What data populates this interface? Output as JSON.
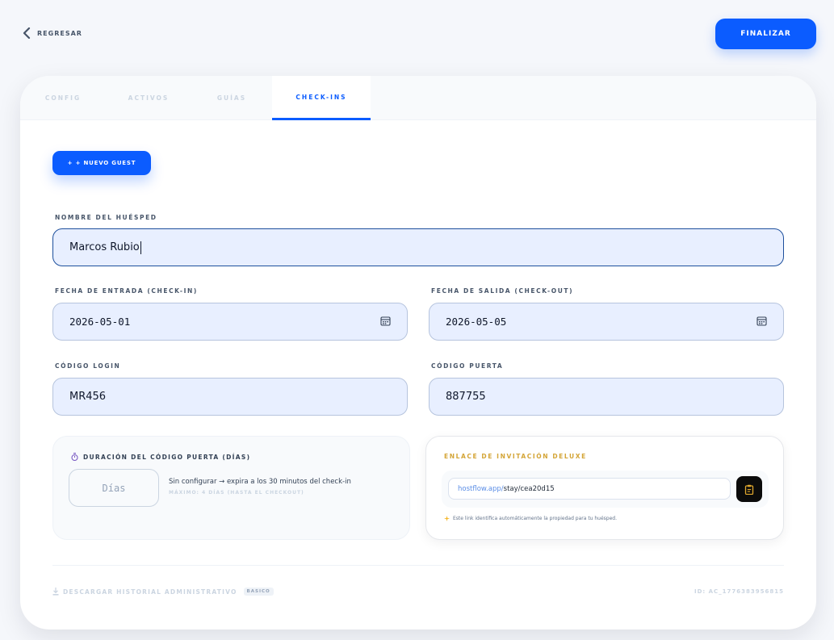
{
  "header": {
    "back_label": "REGRESAR",
    "finish_label": "FINALIZAR"
  },
  "tabs": [
    {
      "label": "CONFIG",
      "active": false
    },
    {
      "label": "ACTIVOS",
      "active": false
    },
    {
      "label": "GUÍAS",
      "active": false
    },
    {
      "label": "CHECK-INS",
      "active": true
    }
  ],
  "actions": {
    "new_guest_label": "+ + NUEVO GUEST"
  },
  "form": {
    "guest_name": {
      "label": "NOMBRE DEL HUÉSPED",
      "value": "Marcos Rubio"
    },
    "check_in": {
      "label": "FECHA DE ENTRADA (CHECK-IN)",
      "value": "2026-05-01"
    },
    "check_out": {
      "label": "FECHA DE SALIDA (CHECK-OUT)",
      "value": "2026-05-05"
    },
    "login_code": {
      "label": "CÓDIGO LOGIN",
      "value": "MR456"
    },
    "door_code": {
      "label": "CÓDIGO PUERTA",
      "value": "887755"
    }
  },
  "duration": {
    "title": "DURACIÓN DEL CÓDIGO PUERTA (DÍAS)",
    "placeholder": "Días",
    "note": "Sin configurar → expira a los 30 minutos del check-in",
    "sub_note": "MÁXIMO: 4 DÍAS (HASTA EL CHECKOUT)"
  },
  "invite": {
    "title": "ENLACE DE INVITACIÓN DELUXE",
    "link_host": "hostflow.app/",
    "link_path": "stay/cea20d15",
    "note": "Este link identifica automáticamente la propiedad para tu huésped."
  },
  "footer": {
    "download_label": "DESCARGAR HISTORIAL ADMINISTRATIVO",
    "badge": "BASICO",
    "account_id": "ID: AC_1776383956815"
  },
  "colors": {
    "primary": "#0b5cff",
    "gold": "#d4a537",
    "field_bg": "#e8efff"
  }
}
